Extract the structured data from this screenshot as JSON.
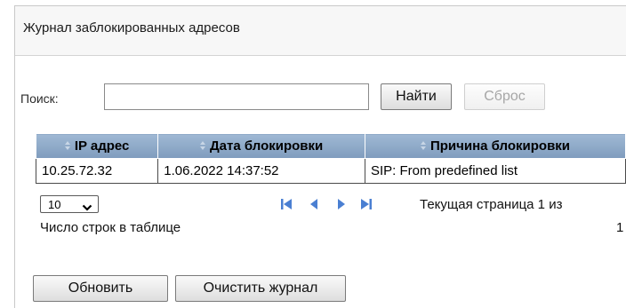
{
  "panel": {
    "title": "Журнал заблокированных адресов"
  },
  "search": {
    "label": "Поиск:",
    "value": "",
    "placeholder": ""
  },
  "buttons": {
    "find": "Найти",
    "reset": "Сброс",
    "refresh": "Обновить",
    "clear": "Очистить журнал"
  },
  "table": {
    "columns": [
      "IP адрес",
      "Дата блокировки",
      "Причина блокировки"
    ],
    "rows": [
      [
        "10.25.72.32",
        "1.06.2022 14:37:52",
        "SIP: From predefined list"
      ]
    ]
  },
  "pager": {
    "page_size": "10",
    "rows_per_table_label": "Число строк в таблице",
    "current_page_text": "Текущая страница 1 из",
    "total_pages": "1"
  },
  "colors": {
    "header_bg": "#8fa9c7",
    "panel_header_bg": "#f7f7f7",
    "pager_icon": "#4a7fd2"
  },
  "icons": {
    "sort": "sort-updown-icon",
    "first": "first-page-icon",
    "prev": "prev-page-icon",
    "next": "next-page-icon",
    "last": "last-page-icon",
    "dropdown": "chevron-down-icon"
  }
}
